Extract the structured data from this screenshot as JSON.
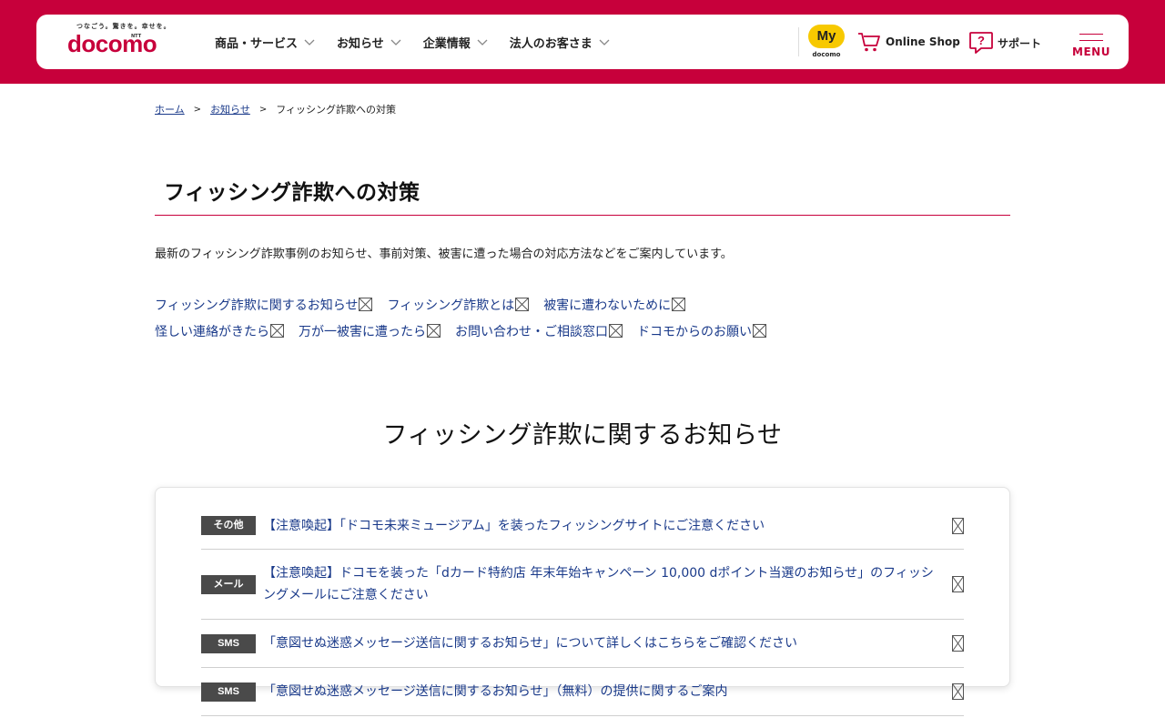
{
  "colors": {
    "brand": "#c7003b",
    "link": "#1a3a8a",
    "tag_bg": "#4a4a4a",
    "mydocomo_yellow": "#f7c900"
  },
  "header": {
    "logo_tagline": "つなごう。驚きを。幸せを。",
    "logo_ntt": "NTT",
    "logo_text": "docomo",
    "nav": [
      {
        "label": "商品・サービス"
      },
      {
        "label": "お知らせ"
      },
      {
        "label": "企業情報"
      },
      {
        "label": "法人のお客さま"
      }
    ],
    "mydocomo_badge": "My",
    "mydocomo_sub": "docomo",
    "online_shop_label": "Online Shop",
    "support_label": "サポート",
    "menu_label": "MENU"
  },
  "breadcrumb": {
    "items": [
      "ホーム",
      "お知らせ",
      "フィッシング詐欺への対策"
    ],
    "separator": ">"
  },
  "page": {
    "title": "フィッシング詐欺への対策",
    "lead": "最新のフィッシング詐欺事例のお知らせ、事前対策、被害に遭った場合の対応方法などをご案内しています。",
    "anchors": [
      "フィッシング詐欺に関するお知らせ",
      "フィッシング詐欺とは",
      "被害に遭わないために",
      "怪しい連絡がきたら",
      "万が一被害に遭ったら",
      "お問い合わせ・ご相談窓口",
      "ドコモからのお願い"
    ]
  },
  "news_section": {
    "title": "フィッシング詐欺に関するお知らせ",
    "items": [
      {
        "tag": "その他",
        "text": "【注意喚起】「ドコモ未来ミュージアム」を装ったフィッシングサイトにご注意ください"
      },
      {
        "tag": "メール",
        "text": "【注意喚起】ドコモを装った「dカード特約店 年末年始キャンペーン 10,000 dポイント当選のお知らせ」のフィッシングメールにご注意ください"
      },
      {
        "tag": "SMS",
        "text": "「意図せぬ迷惑メッセージ送信に関するお知らせ」について詳しくはこちらをご確認ください"
      },
      {
        "tag": "SMS",
        "text": "「意図せぬ迷惑メッセージ送信に関するお知らせ」（無料）の提供に関するご案内"
      }
    ]
  }
}
